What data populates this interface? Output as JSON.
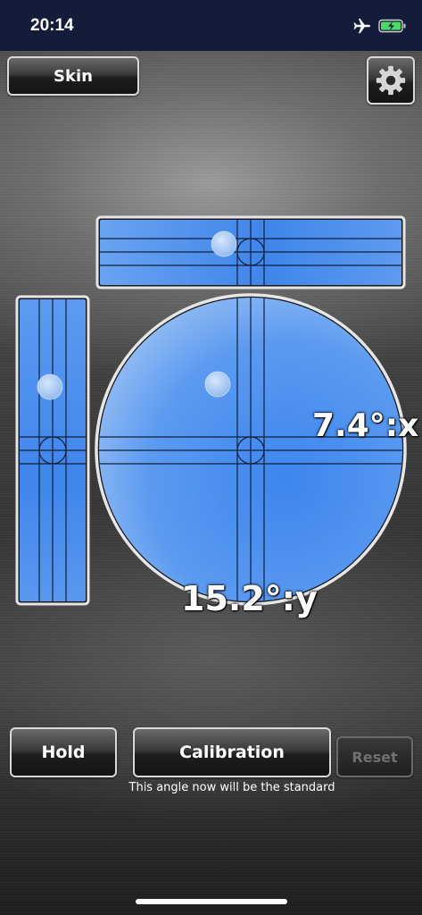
{
  "status_bar": {
    "time": "20:14",
    "icons": [
      "airplane-icon",
      "battery-charging-icon"
    ]
  },
  "toolbar": {
    "skin_label": "Skin",
    "settings_icon": "gear-icon"
  },
  "level": {
    "x_reading": "7.4°:x",
    "y_reading": "15.2°:y",
    "bubble_color": "#5b9af0",
    "frame_color": "#e6e6e6"
  },
  "controls": {
    "hold_label": "Hold",
    "calibration_label": "Calibration",
    "reset_label": "Reset",
    "calibration_hint": "This angle now will be the standard"
  }
}
